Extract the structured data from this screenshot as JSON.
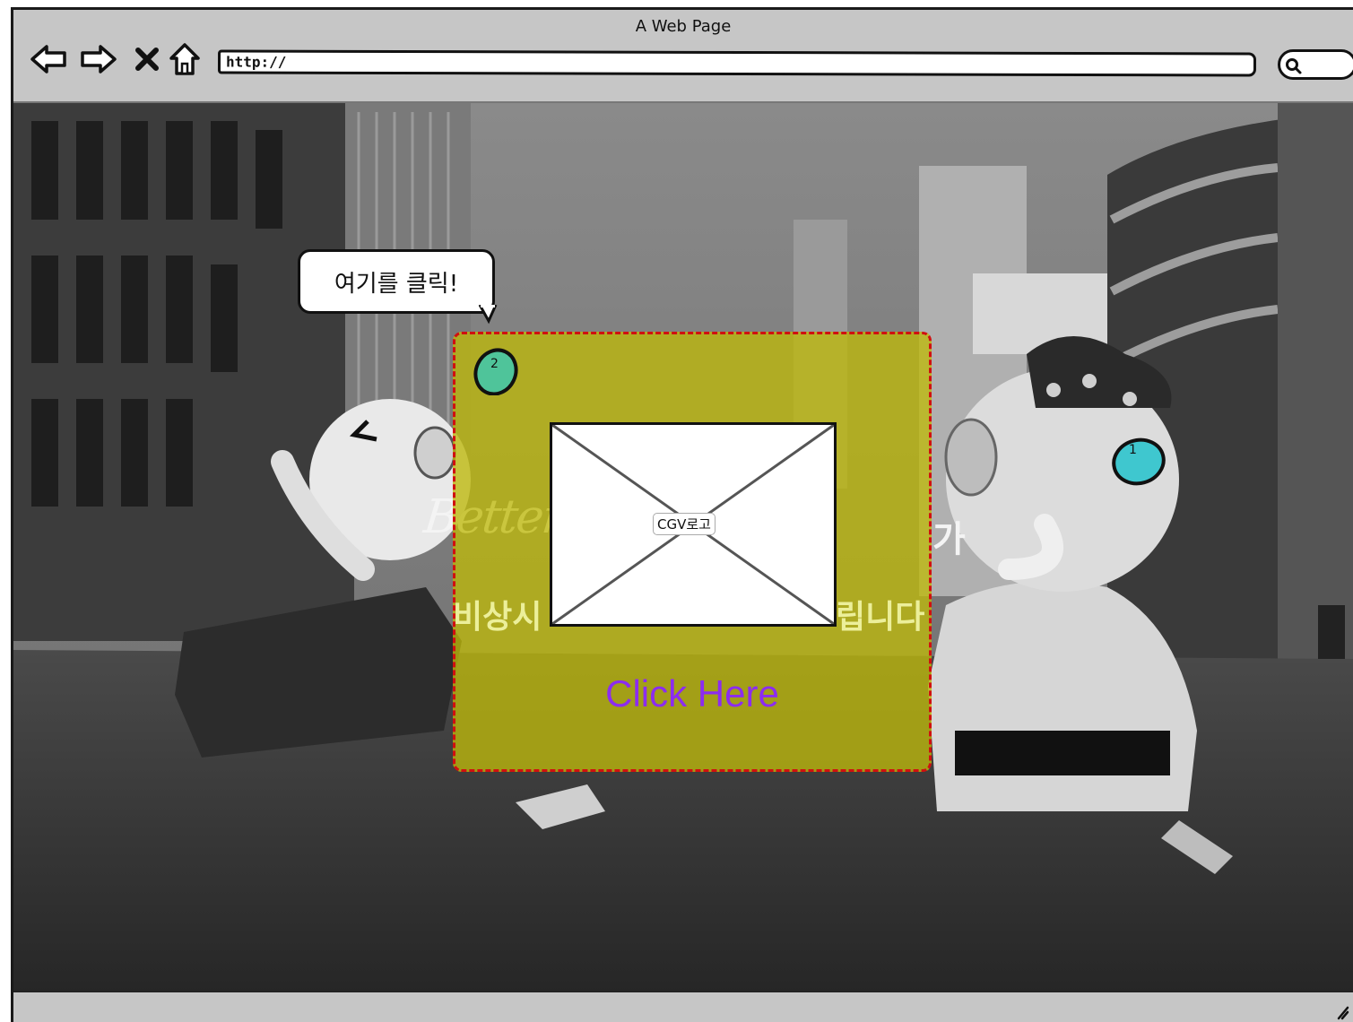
{
  "window": {
    "title": "A Web Page"
  },
  "toolbar": {
    "back_icon": "back-arrow-icon",
    "forward_icon": "forward-arrow-icon",
    "stop_icon": "close-icon",
    "home_icon": "home-icon",
    "url_value": "http://",
    "search_icon": "search-icon"
  },
  "page": {
    "callout_text": "여기를 클릭!",
    "heading_italic": "Better,",
    "heading_korean_fragment": "가",
    "subheading_left": "비상시",
    "subheading_right": "립니다",
    "image_caption": "CGV로고",
    "link_text": "Click Here",
    "markers": [
      {
        "label": "2",
        "color": "#4fc49a"
      },
      {
        "label": "1",
        "color": "#3fc7cf"
      }
    ]
  },
  "colors": {
    "overlay_fill": "#beb90a",
    "overlay_border": "#d01010",
    "link": "#8c2cf0",
    "subheading": "#ecef9a",
    "chrome": "#c6c6c6"
  }
}
